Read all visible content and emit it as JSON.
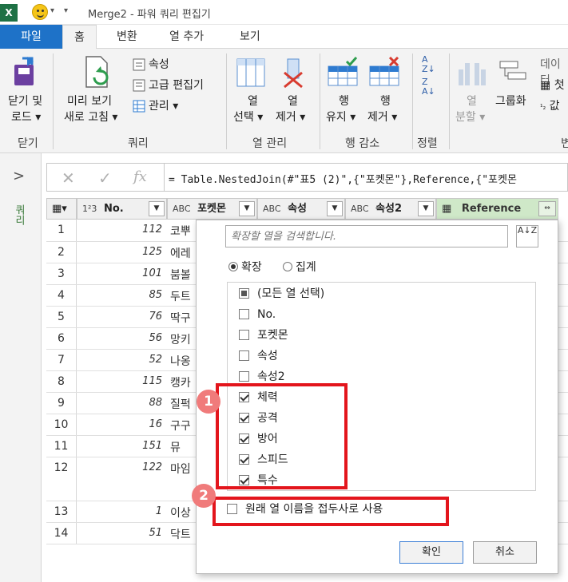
{
  "app": {
    "logo": "X",
    "title": "Merge2 - 파워 쿼리 편집기",
    "qat_dropdown": "▾",
    "qat_more": "▾"
  },
  "tabs": [
    "파일",
    "홈",
    "변환",
    "열 추가",
    "보기"
  ],
  "ribbon": {
    "close_group": {
      "btn_line1": "닫기 및",
      "btn_line2": "로드 ▾",
      "label": "닫기"
    },
    "query_group": {
      "preview_line1": "미리 보기",
      "preview_line2": "새로 고침 ▾",
      "properties": "속성",
      "advanced_editor": "고급 편집기",
      "manage": "관리 ▾",
      "label": "쿼리"
    },
    "column_group": {
      "choose_line1": "열",
      "choose_line2": "선택 ▾",
      "remove_line1": "열",
      "remove_line2": "제거 ▾",
      "label": "열 관리"
    },
    "row_group": {
      "keep_line1": "행",
      "keep_line2": "유지 ▾",
      "remove_line1": "행",
      "remove_line2": "제거 ▾",
      "label": "행 감소"
    },
    "sort_group": {
      "label": "정렬"
    },
    "transform_group": {
      "split_line1": "열",
      "split_line2": "분할 ▾",
      "groupby": "그룹화",
      "datatype": "데이터",
      "first_row": "첫",
      "values": "값",
      "label_partial": "변"
    }
  },
  "side": {
    "query_label": "쿼리"
  },
  "formula": {
    "cancel": "✕",
    "confirm": "✓",
    "fx": "fx",
    "text": "= Table.NestedJoin(#\"표5 (2)\",{\"포켓몬\"},Reference,{\"포켓몬"
  },
  "grid": {
    "headers": {
      "no_type": "1²3",
      "no": "No.",
      "pokemon_type": "ABC",
      "pokemon": "포켓몬",
      "attr_type": "ABC",
      "attr": "속성",
      "attr2_type": "ABC",
      "attr2": "속성2",
      "reference": "Reference"
    },
    "rows": [
      {
        "n": "1",
        "no": "112",
        "name": "코뿌"
      },
      {
        "n": "2",
        "no": "125",
        "name": "에레"
      },
      {
        "n": "3",
        "no": "101",
        "name": "붐볼"
      },
      {
        "n": "4",
        "no": "85",
        "name": "두트"
      },
      {
        "n": "5",
        "no": "76",
        "name": "딱구"
      },
      {
        "n": "6",
        "no": "56",
        "name": "망키"
      },
      {
        "n": "7",
        "no": "52",
        "name": "나옹"
      },
      {
        "n": "8",
        "no": "115",
        "name": "캥카"
      },
      {
        "n": "9",
        "no": "88",
        "name": "질퍽"
      },
      {
        "n": "10",
        "no": "16",
        "name": "구구"
      },
      {
        "n": "11",
        "no": "151",
        "name": "뮤"
      },
      {
        "n": "12",
        "no": "122",
        "name": "마임"
      },
      {
        "n": "13",
        "no": "1",
        "name": "이상"
      },
      {
        "n": "14",
        "no": "51",
        "name": "닥트"
      }
    ]
  },
  "popup": {
    "search_placeholder": "확장할 열을 검색합니다.",
    "sort_icon": "A↓Z",
    "radio_expand": "확장",
    "radio_aggregate": "집계",
    "items": [
      {
        "label": "(모든 열 선택)",
        "state": "partial"
      },
      {
        "label": "No.",
        "state": "off"
      },
      {
        "label": "포켓몬",
        "state": "off"
      },
      {
        "label": "속성",
        "state": "off"
      },
      {
        "label": "속성2",
        "state": "off"
      },
      {
        "label": "체력",
        "state": "on"
      },
      {
        "label": "공격",
        "state": "on"
      },
      {
        "label": "방어",
        "state": "on"
      },
      {
        "label": "스피드",
        "state": "on"
      },
      {
        "label": "특수",
        "state": "on"
      }
    ],
    "prefix_label": "원래 열 이름을 접두사로 사용",
    "ok": "확인",
    "cancel": "취소"
  },
  "annotations": {
    "badge1": "1",
    "badge2": "2",
    "color": "#e3151c"
  }
}
